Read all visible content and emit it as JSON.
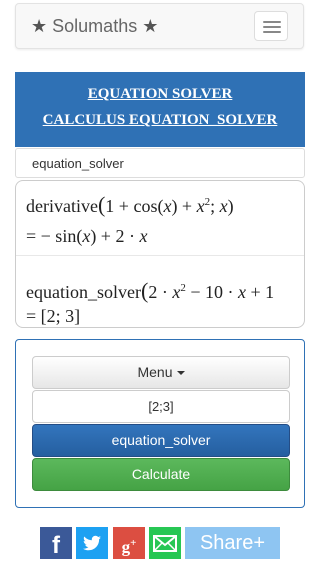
{
  "navbar": {
    "brand_star_left": "★",
    "brand": "Solumaths",
    "brand_star_right": "★"
  },
  "header": {
    "title_line1": "EQUATION SOLVER",
    "title_line2": "CALCULUS EQUATION_SOLVER"
  },
  "breadcrumb": "equation_solver",
  "results": {
    "row1": {
      "fn": "derivative",
      "args_a": "1 + cos(",
      "var1": "x",
      "args_b": ") + ",
      "var2": "x",
      "exp": "2",
      "args_c": "; ",
      "var3": "x",
      "args_d": ")",
      "eq": "=",
      "ans_a": " − sin(",
      "ans_var1": "x",
      "ans_b": ") + 2 · ",
      "ans_var2": "x"
    },
    "row2": {
      "fn": "equation_solver",
      "args_a": "2 · ",
      "var1": "x",
      "exp": "2",
      "args_b": " − 10 · ",
      "var2": "x",
      "args_c": " + 1",
      "eq": "=",
      "ans": " [2; 3]"
    }
  },
  "panel": {
    "menu_label": "Menu",
    "input_value": "[2;3]",
    "solver_label": "equation_solver",
    "calc_label": "Calculate"
  },
  "share": {
    "facebook_glyph": "f",
    "gplus_glyph": "g",
    "gplus_sup": "+",
    "shareplus": "Share+"
  }
}
